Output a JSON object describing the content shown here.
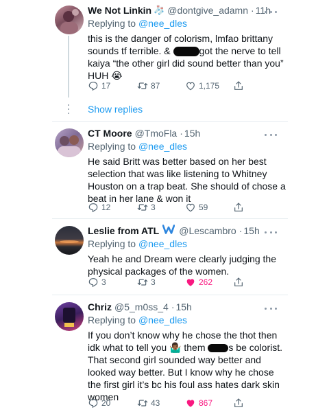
{
  "tweets": [
    {
      "name": "We Not Linkin",
      "name_emoji": "🧦",
      "handle": "@dontgive_adamn",
      "time": "11h",
      "reply_prefix": "Replying to",
      "reply_to": "@nee_dles",
      "text_a": "this is the danger of colorism, lmfao brittany sounds tf terrible. & ",
      "text_b": "got the nerve to tell kaiya “the other girl did sound better than you” HUH 😭",
      "replies": "17",
      "retweets": "87",
      "likes": "1,175"
    },
    {
      "name": "CT Moore",
      "handle": "@TmoFla",
      "time": "15h",
      "reply_prefix": "Replying to",
      "reply_to": "@nee_dles",
      "text": "He said Britt was better based on her best selection that was like listening to Whitney Houston on a trap beat. She should of chose a beat in her lane & won it",
      "replies": "12",
      "retweets": "3",
      "likes": "59"
    },
    {
      "name": "Leslie from ATL",
      "name_emoji": "W",
      "handle": "@Lescambro",
      "time": "15h",
      "reply_prefix": "Replying to",
      "reply_to": "@nee_dles",
      "text": "Yeah he and Dream were clearly judging the physical packages of the women.",
      "replies": "3",
      "retweets": "3",
      "likes": "262"
    },
    {
      "name": "Chriz",
      "handle": "@5_m0ss_4",
      "time": "15h",
      "reply_prefix": "Replying to",
      "reply_to": "@nee_dles",
      "text_a": "If you don’t know why he chose the thot then idk what to tell you 🤷🏾‍♂️ them ",
      "text_b": "s be colorist. That second girl sounded way better and looked way better. But I know why he chose the first girl it’s bc his foul ass hates dark skin women",
      "replies": "20",
      "retweets": "43",
      "likes": "867"
    }
  ],
  "show_replies": "Show replies",
  "colors": {
    "like_active": "#f91880",
    "link": "#1d9bf0",
    "muted": "#536471"
  }
}
